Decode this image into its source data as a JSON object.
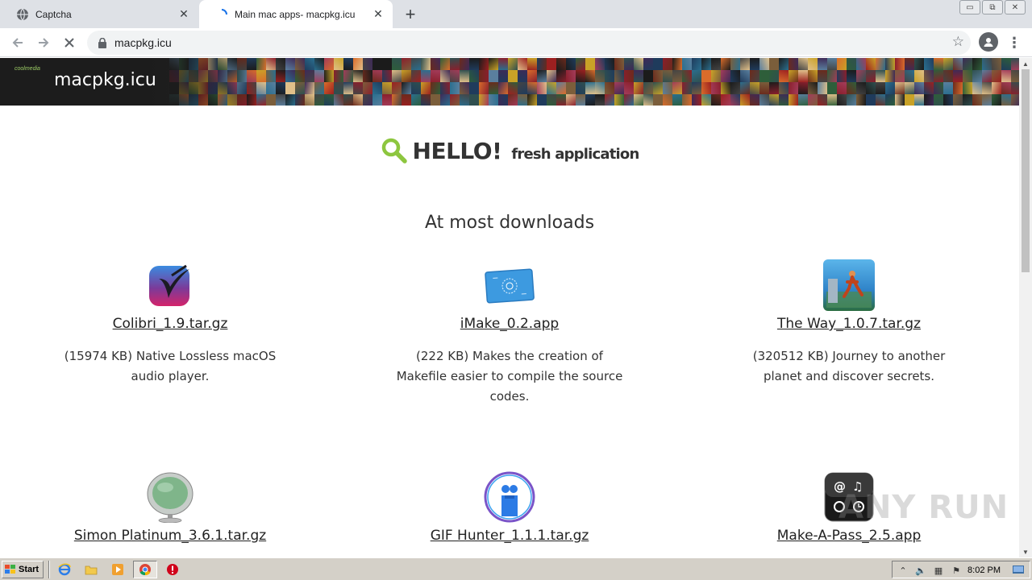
{
  "browser": {
    "tabs": [
      {
        "title": "Captcha",
        "active": false
      },
      {
        "title": "Main mac apps- macpkg.icu",
        "active": true
      }
    ],
    "url": "macpkg.icu",
    "close_glyph": "✕",
    "new_tab_glyph": "+",
    "window_controls": [
      "▭",
      "⧉",
      "✕"
    ]
  },
  "site": {
    "title": "macpkg.icu",
    "logo_small": "coolmedia"
  },
  "hero": {
    "hello": "HELLO!",
    "tagline": "fresh application"
  },
  "section_title": "At most downloads",
  "apps": [
    {
      "name": "Colibri_1.9.tar.gz",
      "desc": "(15974 KB) Native Lossless macOS audio player.",
      "icon": "colibri-icon"
    },
    {
      "name": "iMake_0.2.app",
      "desc": "(222 KB) Makes the creation of Makefile easier to compile the source codes.",
      "icon": "imake-icon"
    },
    {
      "name": "The Way_1.0.7.tar.gz",
      "desc": "(320512 KB) Journey to another planet and discover secrets.",
      "icon": "the-way-icon"
    },
    {
      "name": "Simon Platinum_3.6.1.tar.gz",
      "desc": "",
      "icon": "simon-icon"
    },
    {
      "name": "GIF Hunter_1.1.1.tar.gz",
      "desc": "",
      "icon": "gif-hunter-icon"
    },
    {
      "name": "Make-A-Pass_2.5.app",
      "desc": "",
      "icon": "make-a-pass-icon"
    }
  ],
  "watermark": "ANY RUN",
  "taskbar": {
    "start_label": "Start",
    "clock": "8:02 PM"
  },
  "colors": {
    "accent_green": "#8dc63f",
    "chrome_tabstrip": "#dee1e6",
    "taskbar": "#d4d0c8"
  }
}
